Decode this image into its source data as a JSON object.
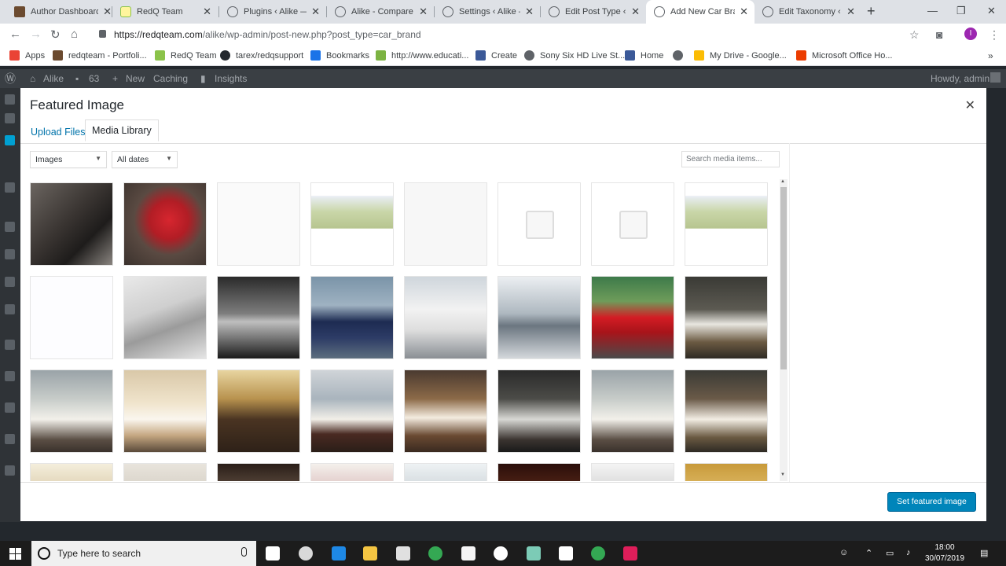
{
  "browser": {
    "tabs": [
      {
        "title": "Author Dashboard",
        "icon": "author-favicon"
      },
      {
        "title": "RedQ Team",
        "icon": "redq-favicon"
      },
      {
        "title": "Plugins ‹ Alike — W",
        "icon": "wordpress-favicon"
      },
      {
        "title": "Alike - Compare W",
        "icon": "wordpress-favicon"
      },
      {
        "title": "Settings ‹ Alike —",
        "icon": "wordpress-favicon"
      },
      {
        "title": "Edit Post Type ‹ Ali",
        "icon": "wordpress-favicon"
      },
      {
        "title": "Add New Car Bran",
        "icon": "wordpress-favicon"
      },
      {
        "title": "Edit Taxonomy ‹ Ali",
        "icon": "wordpress-favicon"
      }
    ],
    "active_tab_index": 6,
    "url_host": "https://redqteam.com",
    "url_path": "/alike/wp-admin/post-new.php?post_type=car_brand",
    "profile_initial": "I",
    "bookmarks": [
      {
        "label": "Apps",
        "color": "#ea4335"
      },
      {
        "label": "redqteam - Portfoli...",
        "color": "#6b4a2f"
      },
      {
        "label": "RedQ Team",
        "color": "#8bc34a"
      },
      {
        "label": "tarex/redqsupport",
        "color": "#24292e"
      },
      {
        "label": "Bookmarks",
        "color": "#1a73e8"
      },
      {
        "label": "http://www.educati...",
        "color": "#7cb342"
      },
      {
        "label": "Create",
        "color": "#3b5998"
      },
      {
        "label": "Sony Six HD Live St...",
        "color": "#5f6368"
      },
      {
        "label": "Home",
        "color": "#3b5998"
      },
      {
        "label": "",
        "color": "#5f6368"
      },
      {
        "label": "My Drive - Google...",
        "color": "#fbbc04"
      },
      {
        "label": "Microsoft Office Ho...",
        "color": "#eb3c00"
      }
    ]
  },
  "wp_admin_bar": {
    "site": "Alike",
    "comments": "63",
    "new": "New",
    "caching": "Caching",
    "insights": "Insights",
    "howdy": "Howdy, admin"
  },
  "modal": {
    "title": "Featured Image",
    "tabs": {
      "upload": "Upload Files",
      "library": "Media Library"
    },
    "filters": {
      "type": "Images",
      "date": "All dates"
    },
    "search_placeholder": "Search media items...",
    "primary_button": "Set featured image",
    "thumbnails": [
      {
        "name": "motorcycle",
        "bg": "linear-gradient(135deg,#6b6560 0%,#3a3532 45%,#1e1c1b 70%,#8a8580 100%)"
      },
      {
        "name": "red-scooter",
        "bg": "radial-gradient(circle at 55% 45%,#d7262f 0%,#b21d25 30%,#5a4a42 55%,#3b322d 100%)"
      },
      {
        "name": "doc-screenshot",
        "bg": "#fafafa"
      },
      {
        "name": "landscape-screenshot",
        "bg": "linear-gradient(180deg,#fff 0%,#fff 15%,#e9eef4 16%,#c9d6a8 35%,#b7c590 55%,#fff 56%,#fff 100%)"
      },
      {
        "name": "blank-screenshot",
        "bg": "#f7f7f7"
      },
      {
        "name": "placeholder",
        "bg": "#fff"
      },
      {
        "name": "placeholder",
        "bg": "#fff"
      },
      {
        "name": "landscape-screenshot",
        "bg": "linear-gradient(180deg,#fff 0%,#fff 15%,#e9eef4 16%,#c9d6a8 35%,#b7c590 55%,#fff 56%,#fff 100%)"
      },
      {
        "name": "admin-screenshot",
        "bg": "#fdfdff"
      },
      {
        "name": "silver-audi",
        "bg": "linear-gradient(160deg,#e9e9e9 0%,#cfcfcf 40%,#9b9b9b 62%,#e5e5e5 100%)"
      },
      {
        "name": "audi-dark",
        "bg": "linear-gradient(180deg,#2a2a2a 0%,#7d7d7d 45%,#bfbfbf 55%,#1a1a1a 100%)"
      },
      {
        "name": "blue-bmw",
        "bg": "linear-gradient(180deg,#7a94a8 0%,#9fb2c2 35%,#1d2b52 55%,#2d3c66 75%,#5d6e7e 100%)"
      },
      {
        "name": "white-bmw",
        "bg": "linear-gradient(180deg,#cfd6dc 0%,#f2f2f2 40%,#dedede 65%,#8a8f94 100%)"
      },
      {
        "name": "bmw-i8",
        "bg": "linear-gradient(180deg,#eceff2 0%,#aeb8c0 45%,#6b7680 60%,#d4d8dc 100%)"
      },
      {
        "name": "red-ferrari",
        "bg": "linear-gradient(180deg,#3d7a4a 0%,#6e9c5a 30%,#d31c24 50%,#a8141a 68%,#4a4a4a 100%)"
      },
      {
        "name": "hotel-room",
        "bg": "linear-gradient(180deg,#3a3a35 0%,#5c5a52 40%,#e8e6e0 58%,#6b5a42 80%,#2e2a24 100%)"
      },
      {
        "name": "hotel-room",
        "bg": "linear-gradient(180deg,#9aa3a8 0%,#c7ccc9 35%,#f2f0ea 60%,#5a4e44 85%,#3a322c 100%)"
      },
      {
        "name": "hotel-room",
        "bg": "linear-gradient(180deg,#d9c8a8 0%,#f0e4cc 40%,#faf6ee 60%,#c4a680 80%,#5a4a3a 100%)"
      },
      {
        "name": "hotel-room",
        "bg": "linear-gradient(180deg,#e8d5a0 0%,#b8924e 35%,#4a3422 60%,#2e2118 100%)"
      },
      {
        "name": "hotel-room",
        "bg": "linear-gradient(180deg,#d0d4d8 0%,#a9b4bd 35%,#f2efe8 60%,#4a2a22 78%,#2a1e18 100%)"
      },
      {
        "name": "hotel-room",
        "bg": "linear-gradient(180deg,#4a3a30 0%,#8c6a48 35%,#f4ece0 58%,#6a4a32 80%,#3a2a20 100%)"
      },
      {
        "name": "hotel-room",
        "bg": "linear-gradient(180deg,#2a2a2a 0%,#4c4c48 35%,#d8d8d4 60%,#3a3430 85%,#1a1a1a 100%)"
      },
      {
        "name": "hotel-room",
        "bg": "linear-gradient(180deg,#9aa3a8 0%,#c7ccc9 35%,#f2f0ea 60%,#5a4e44 85%,#3a322c 100%)"
      },
      {
        "name": "hotel-room",
        "bg": "linear-gradient(180deg,#3a3a35 0%,#6a5a48 35%,#f2ede4 60%,#6b5a42 82%,#2e2a24 100%)"
      },
      {
        "name": "hotel-room",
        "bg": "linear-gradient(180deg,#f4eedc 0%,#cbb68c 60%,#a89a78 100%)"
      },
      {
        "name": "hotel-room",
        "bg": "linear-gradient(180deg,#e8e4dc 0%,#c8c0b4 60%,#9a8e80 100%)"
      },
      {
        "name": "hotel-room",
        "bg": "linear-gradient(180deg,#2a1e18 0%,#8a7462 60%,#c4b4a4 100%)"
      },
      {
        "name": "hotel-room",
        "bg": "linear-gradient(180deg,#f4f0ec 0%,#c89a9a 60%,#8a6a6a 100%)"
      },
      {
        "name": "hotel-room",
        "bg": "linear-gradient(180deg,#eef2f4 0%,#b4bec4 60%,#8a949a 100%)"
      },
      {
        "name": "restaurant",
        "bg": "linear-gradient(180deg,#2a0e0a 0%,#7a3a22 60%,#c46a3a 100%)"
      },
      {
        "name": "hotel-room",
        "bg": "linear-gradient(180deg,#f4f4f4 0%,#bcbcbc 60%,#9a9a9a 100%)"
      },
      {
        "name": "hotel-room",
        "bg": "linear-gradient(180deg,#c89a3a 0%,#f0d48a 60%,#a07a2a 100%)"
      }
    ]
  },
  "taskbar": {
    "search_text": "Type here to search",
    "time": "18:00",
    "date": "30/07/2019",
    "apps": [
      {
        "name": "task-view",
        "color": "#ffffff"
      },
      {
        "name": "obs",
        "color": "#d9d9d9"
      },
      {
        "name": "edge",
        "color": "#1e88e5"
      },
      {
        "name": "file-explorer",
        "color": "#f4c542"
      },
      {
        "name": "camera",
        "color": "#e0e0e0"
      },
      {
        "name": "chrome",
        "color": "#34a853"
      },
      {
        "name": "store",
        "color": "#f5f5f5"
      },
      {
        "name": "hp",
        "color": "#ffffff"
      },
      {
        "name": "app-green",
        "color": "#7ccbb6"
      },
      {
        "name": "mail",
        "color": "#ffffff"
      },
      {
        "name": "chrome-badge",
        "color": "#34a853"
      },
      {
        "name": "slack",
        "color": "#e01e5a"
      }
    ]
  }
}
